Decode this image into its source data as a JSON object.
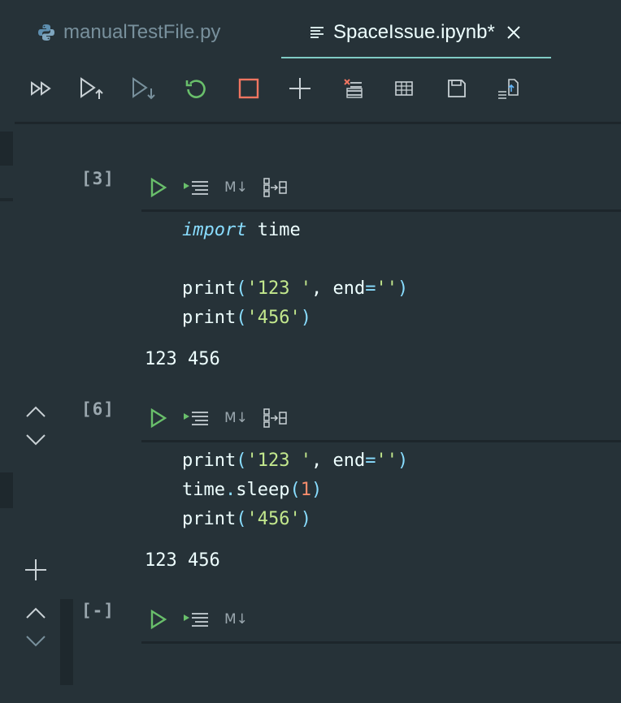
{
  "tabs": [
    {
      "label": "manualTestFile.py",
      "icon": "python-icon"
    },
    {
      "label": "SpaceIssue.ipynb*",
      "icon": "notebook-icon"
    }
  ],
  "toolbar": {
    "items": [
      "run-all-icon",
      "run-above-icon",
      "run-below-icon",
      "restart-kernel-icon",
      "interrupt-kernel-icon",
      "add-cell-icon",
      "clear-outputs-icon",
      "variables-icon",
      "save-icon",
      "export-icon"
    ]
  },
  "cells": [
    {
      "exec": "[3]",
      "md_label": "M↓",
      "lines": [
        [
          {
            "t": "kw",
            "v": "import"
          },
          {
            "t": "tx",
            "v": " time"
          }
        ],
        [],
        [
          {
            "t": "tx",
            "v": "print"
          },
          {
            "t": "pn",
            "v": "("
          },
          {
            "t": "st",
            "v": "'123 '"
          },
          {
            "t": "tx",
            "v": ", end"
          },
          {
            "t": "pn",
            "v": "="
          },
          {
            "t": "st",
            "v": "''"
          },
          {
            "t": "pn",
            "v": ")"
          }
        ],
        [
          {
            "t": "tx",
            "v": "print"
          },
          {
            "t": "pn",
            "v": "("
          },
          {
            "t": "st",
            "v": "'456'"
          },
          {
            "t": "pn",
            "v": ")"
          }
        ]
      ],
      "output": "123 456"
    },
    {
      "exec": "[6]",
      "md_label": "M↓",
      "lines": [
        [
          {
            "t": "tx",
            "v": "print"
          },
          {
            "t": "pn",
            "v": "("
          },
          {
            "t": "st",
            "v": "'123 '"
          },
          {
            "t": "tx",
            "v": ", end"
          },
          {
            "t": "pn",
            "v": "="
          },
          {
            "t": "st",
            "v": "''"
          },
          {
            "t": "pn",
            "v": ")"
          }
        ],
        [
          {
            "t": "tx",
            "v": "time"
          },
          {
            "t": "pn",
            "v": "."
          },
          {
            "t": "tx",
            "v": "sleep"
          },
          {
            "t": "pn",
            "v": "("
          },
          {
            "t": "nm",
            "v": "1"
          },
          {
            "t": "pn",
            "v": ")"
          }
        ],
        [
          {
            "t": "tx",
            "v": "print"
          },
          {
            "t": "pn",
            "v": "("
          },
          {
            "t": "st",
            "v": "'456'"
          },
          {
            "t": "pn",
            "v": ")"
          }
        ]
      ],
      "output": "123 456"
    },
    {
      "exec": "[-]",
      "md_label": "M↓"
    }
  ],
  "colors": {
    "background": "#263238",
    "accent": "#80cbc4",
    "run_green": "#69bf6b",
    "stop_red": "#f07561"
  }
}
